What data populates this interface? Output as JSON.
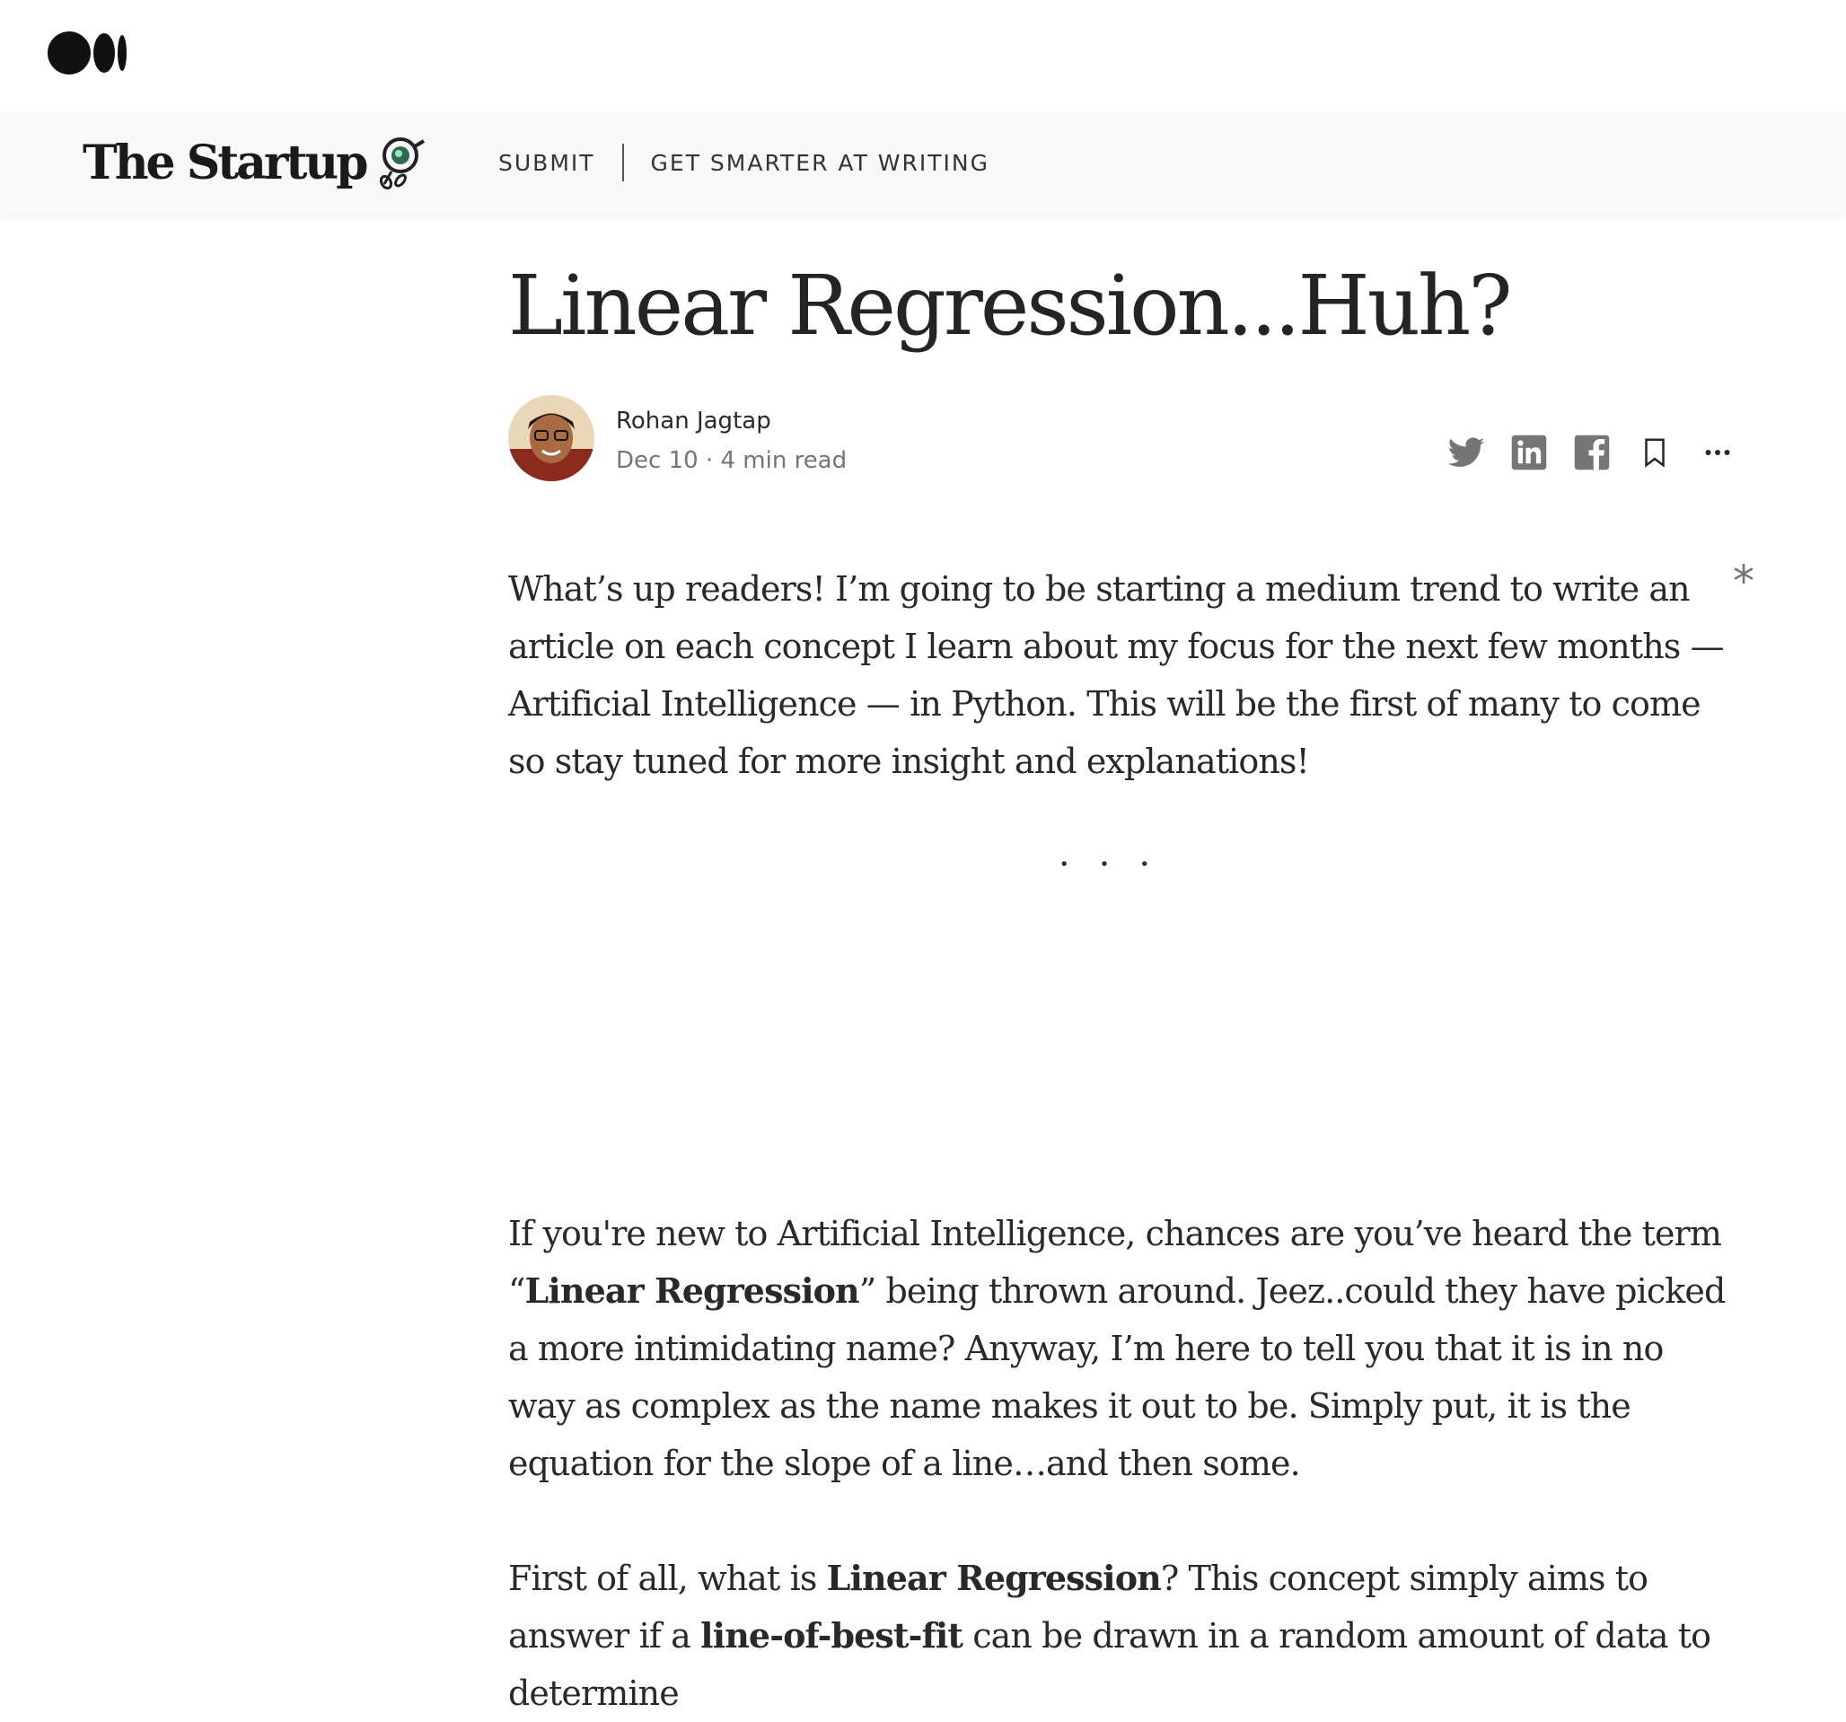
{
  "header": {
    "publication_name": "The Startup",
    "nav": {
      "submit": "SUBMIT",
      "writing": "GET SMARTER AT WRITING"
    }
  },
  "article": {
    "title": "Linear Regression...Huh?",
    "author": "Rohan Jagtap",
    "date": "Dec 10",
    "read_time": "4 min read",
    "asterisk": "*",
    "separator": "...",
    "p1": "What’s up readers! I’m going to be starting a medium trend to write an article on each concept I learn about my focus for the next few months — Artificial Intelligence — in Python. This will be the first of many to come so stay tuned for more insight and explanations!",
    "p2": {
      "a": "If you're new to Artificial Intelligence, chances are you’ve heard the term “",
      "b": "Linear Regression",
      "c": "” being thrown around. Jeez..could they have picked a more intimidating name? Anyway, I’m here to tell you that it is in no way as complex as the name makes it out to be. Simply put, it is the equation for the slope of a line…and then some."
    },
    "p3": {
      "a": "First of all, what is ",
      "b": "Linear Regression",
      "c": "? This concept simply aims to answer if a ",
      "d": "line-of-best-fit",
      "e": " can be drawn in a random amount of data to determine"
    }
  },
  "icons": {
    "medium_logo": "medium-logo-icon",
    "twitter": "twitter-icon",
    "linkedin": "linkedin-icon",
    "facebook": "facebook-icon",
    "bookmark": "bookmark-icon",
    "more": "more-options-icon"
  },
  "colors": {
    "text": "#292929",
    "meta": "#757575",
    "nav_bg": "#f8f8f8"
  }
}
